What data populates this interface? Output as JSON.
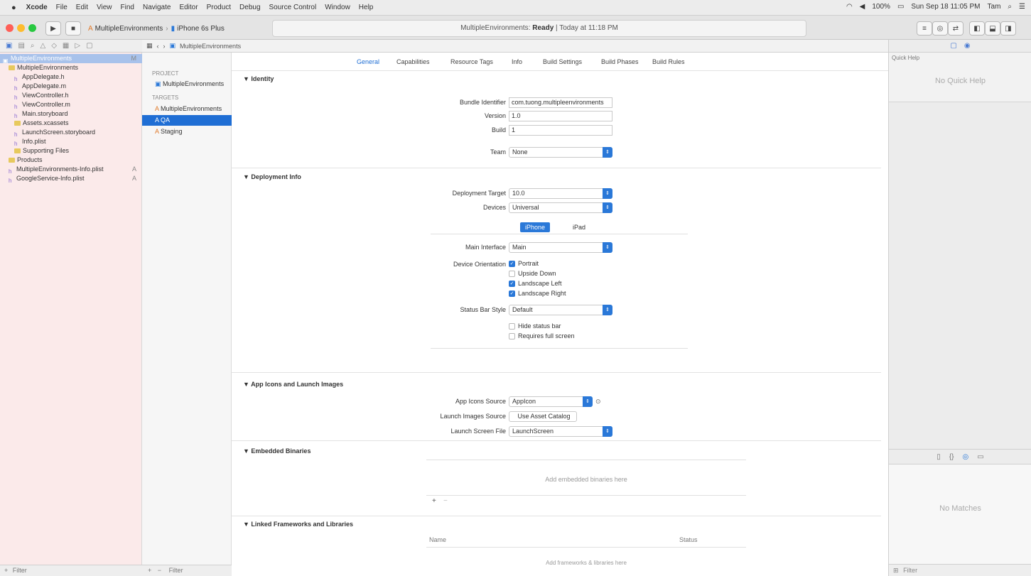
{
  "menubar": {
    "apple_icon": "apple-icon",
    "items": [
      "Xcode",
      "File",
      "Edit",
      "View",
      "Find",
      "Navigate",
      "Editor",
      "Product",
      "Debug",
      "Source Control",
      "Window",
      "Help"
    ],
    "right_status": [
      "100%",
      "Sun Sep 18 11:05 PM",
      "Tam"
    ]
  },
  "toolbar": {
    "scheme_name": "MultipleEnvironments",
    "device_name": "iPhone 6s Plus",
    "status_project": "MultipleEnvironments",
    "status_state": "Ready",
    "status_time": "Today at 11:18 PM",
    "light_colors": [
      "#ff5f57",
      "#febc2e",
      "#28c840"
    ]
  },
  "navigator": {
    "rows": [
      {
        "label": "MultipleEnvironments",
        "badge": "M",
        "indent": 0,
        "icon": "project",
        "selected": true
      },
      {
        "label": "MultipleEnvironments",
        "badge": "",
        "indent": 1,
        "icon": "folder",
        "selected": false
      },
      {
        "label": "AppDelegate.h",
        "badge": "",
        "indent": 2,
        "icon": "file",
        "selected": false
      },
      {
        "label": "AppDelegate.m",
        "badge": "",
        "indent": 2,
        "icon": "file",
        "selected": false
      },
      {
        "label": "ViewController.h",
        "badge": "",
        "indent": 2,
        "icon": "file",
        "selected": false
      },
      {
        "label": "ViewController.m",
        "badge": "",
        "indent": 2,
        "icon": "file",
        "selected": false
      },
      {
        "label": "Main.storyboard",
        "badge": "",
        "indent": 2,
        "icon": "file",
        "selected": false
      },
      {
        "label": "Assets.xcassets",
        "badge": "",
        "indent": 2,
        "icon": "folder",
        "selected": false
      },
      {
        "label": "LaunchScreen.storyboard",
        "badge": "",
        "indent": 2,
        "icon": "file",
        "selected": false
      },
      {
        "label": "Info.plist",
        "badge": "",
        "indent": 2,
        "icon": "file",
        "selected": false
      },
      {
        "label": "Supporting Files",
        "badge": "",
        "indent": 2,
        "icon": "folder",
        "selected": false
      },
      {
        "label": "Products",
        "badge": "",
        "indent": 1,
        "icon": "folder",
        "selected": false
      },
      {
        "label": "MultipleEnvironments-Info.plist",
        "badge": "A",
        "indent": 1,
        "icon": "file",
        "selected": false
      },
      {
        "label": "GoogleService-Info.plist",
        "badge": "A",
        "indent": 1,
        "icon": "file",
        "selected": false
      }
    ]
  },
  "jumpbar": {
    "crumb": "MultipleEnvironments"
  },
  "targets": {
    "project_header": "PROJECT",
    "project_item": "MultipleEnvironments",
    "targets_header": "TARGETS",
    "items": [
      "MultipleEnvironments",
      "QA",
      "Staging"
    ]
  },
  "settings_tabs": [
    "General",
    "Capabilities",
    "Resource Tags",
    "Info",
    "Build Settings",
    "Build Phases",
    "Build Rules"
  ],
  "identity": {
    "title": "Identity",
    "bundle_label": "Bundle Identifier",
    "bundle_value": "com.tuong.multipleenvironments",
    "version_label": "Version",
    "version_value": "1.0",
    "build_label": "Build",
    "build_value": "1",
    "team_label": "Team",
    "team_value": "None"
  },
  "deployment": {
    "title": "Deployment Info",
    "target_label": "Deployment Target",
    "target_value": "10.0",
    "devices_label": "Devices",
    "devices_value": "Universal",
    "seg_iphone": "iPhone",
    "seg_ipad": "iPad",
    "main_interface_label": "Main Interface",
    "main_interface_value": "Main",
    "orientation_label": "Device Orientation",
    "orientations": [
      {
        "label": "Portrait",
        "checked": true
      },
      {
        "label": "Upside Down",
        "checked": false
      },
      {
        "label": "Landscape Left",
        "checked": true
      },
      {
        "label": "Landscape Right",
        "checked": true
      }
    ],
    "status_bar_label": "Status Bar Style",
    "status_bar_value": "Default",
    "status_checks": [
      {
        "label": "Hide status bar",
        "checked": false
      },
      {
        "label": "Requires full screen",
        "checked": false
      }
    ]
  },
  "appicons": {
    "title": "App Icons and Launch Images",
    "icons_label": "App Icons Source",
    "icons_value": "AppIcon",
    "launch_images_label": "Launch Images Source",
    "launch_images_button": "Use Asset Catalog",
    "launch_screen_label": "Launch Screen File",
    "launch_screen_value": "LaunchScreen"
  },
  "embedded": {
    "title": "Embedded Binaries",
    "placeholder": "Add embedded binaries here",
    "add_icon": "+",
    "remove_icon": "−"
  },
  "linked": {
    "title": "Linked Frameworks and Libraries",
    "col_name": "Name",
    "col_status": "Status",
    "placeholder": "Add frameworks & libraries here"
  },
  "inspector": {
    "quick_help_header": "Quick Help",
    "no_quick_help": "No Quick Help",
    "no_matches": "No Matches",
    "filter_placeholder": "Filter"
  },
  "footers": {
    "nav_filter": "Filter",
    "targets_add": "+",
    "targets_remove": "−",
    "targets_filter": "Filter"
  }
}
